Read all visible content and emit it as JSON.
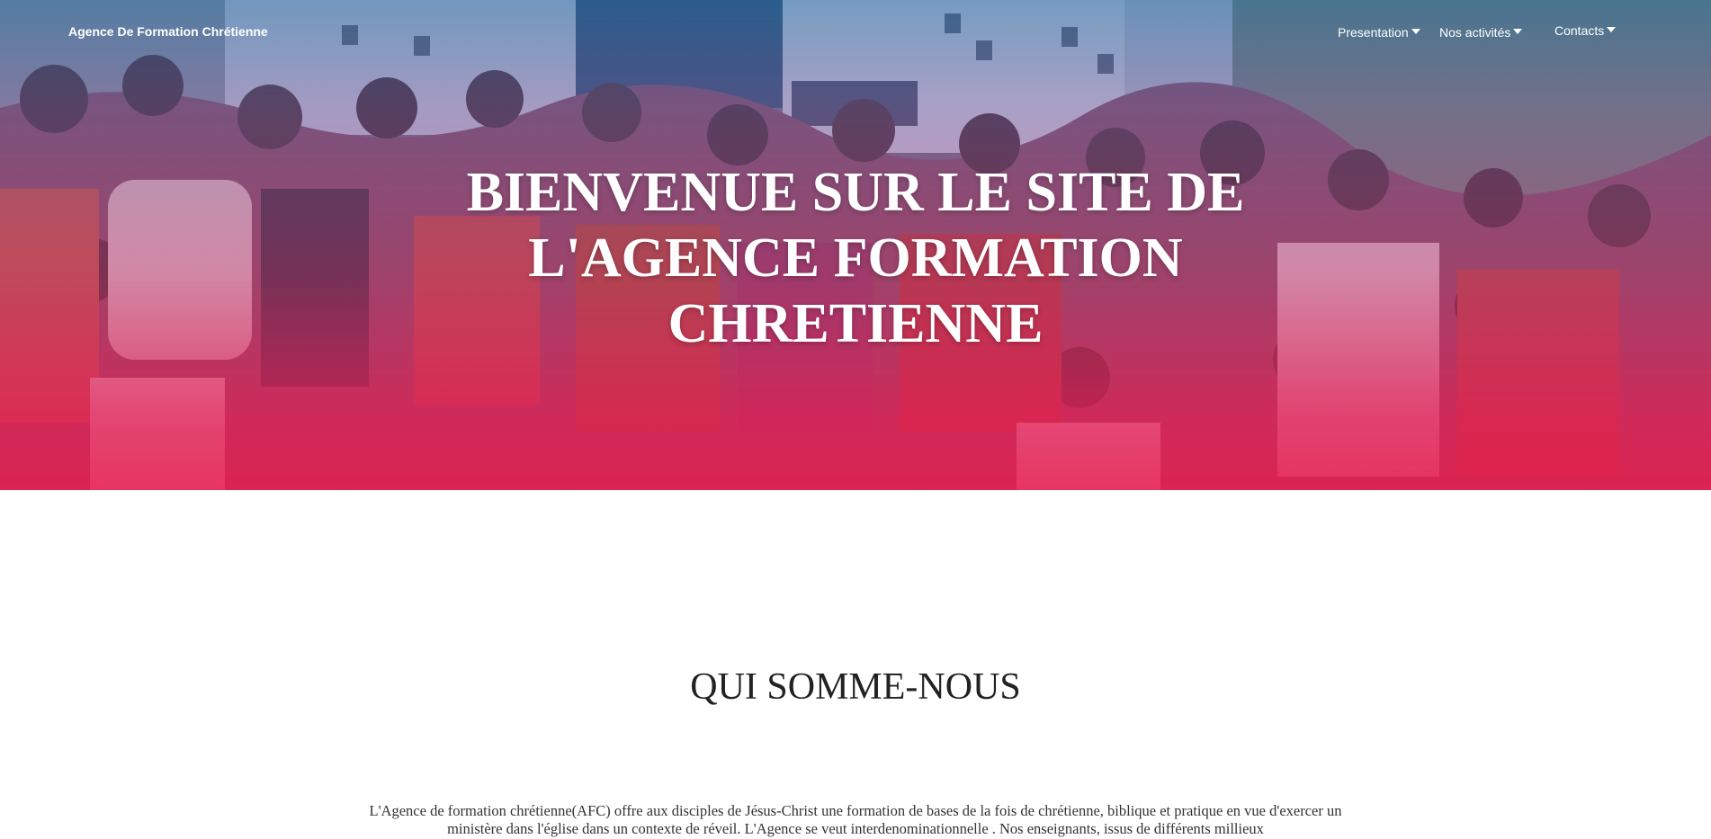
{
  "nav": {
    "brand": "Agence De Formation Chrétienne",
    "items": [
      {
        "label": "Presentation"
      },
      {
        "label": "Nos activités"
      },
      {
        "label": "Contacts"
      }
    ]
  },
  "hero": {
    "title": "BIENVENUE SUR LE SITE DE L'AGENCE FORMATION CHRETIENNE",
    "image_alt": "group photo"
  },
  "about": {
    "title": "QUI SOMME-NOUS",
    "text": "L'Agence de formation chrétienne(AFC) offre aux disciples de Jésus-Christ une formation de bases de la fois de chrétienne, biblique et pratique en vue d'exercer un ministère dans l'église dans un contexte de réveil. L'Agence se veut interdenominationnelle . Nos enseignants, issus de différents millieux"
  },
  "colors": {
    "gradient_top": "#3a78b4",
    "gradient_bottom": "#e81e50",
    "text_dark": "#222222"
  }
}
